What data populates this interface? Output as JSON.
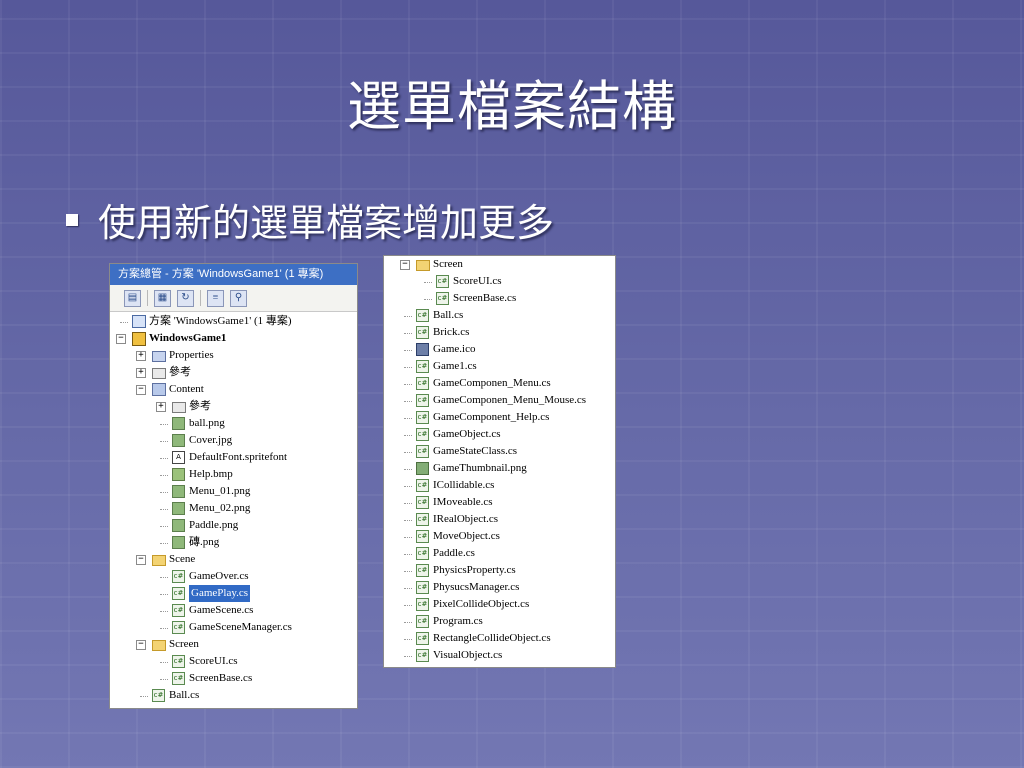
{
  "slide": {
    "title": "選單檔案結構",
    "bullet": "使用新的選單檔案增加更多"
  },
  "left_panel": {
    "title": "方案總管 - 方案 'WindowsGame1' (1 專案)",
    "toolbar_icons": [
      "properties-icon",
      "show-all-files-icon",
      "refresh-icon",
      "view-code-icon",
      "class-diagram-icon"
    ],
    "items": [
      {
        "label": "方案 'WindowsGame1' (1 專案)",
        "icon": "solution-icon",
        "level": 0
      },
      {
        "label": "WindowsGame1",
        "icon": "project-icon",
        "level": 0,
        "toggle": "−",
        "bold": true
      },
      {
        "label": "Properties",
        "icon": "properties-folder-icon",
        "level": 1,
        "toggle": "+"
      },
      {
        "label": "參考",
        "icon": "references-icon",
        "level": 1,
        "toggle": "+"
      },
      {
        "label": "Content",
        "icon": "content-icon",
        "level": 1,
        "toggle": "−"
      },
      {
        "label": "參考",
        "icon": "references-icon",
        "level": 2,
        "toggle": "+"
      },
      {
        "label": "ball.png",
        "icon": "image-file-icon",
        "level": 2
      },
      {
        "label": "Cover.jpg",
        "icon": "image-file-icon",
        "level": 2
      },
      {
        "label": "DefaultFont.spritefont",
        "icon": "font-file-icon",
        "level": 2
      },
      {
        "label": "Help.bmp",
        "icon": "bitmap-file-icon",
        "level": 2
      },
      {
        "label": "Menu_01.png",
        "icon": "image-file-icon",
        "level": 2
      },
      {
        "label": "Menu_02.png",
        "icon": "image-file-icon",
        "level": 2
      },
      {
        "label": "Paddle.png",
        "icon": "image-file-icon",
        "level": 2
      },
      {
        "label": "磚.png",
        "icon": "image-file-icon",
        "level": 2
      },
      {
        "label": "Scene",
        "icon": "folder-icon",
        "level": 1,
        "toggle": "−"
      },
      {
        "label": "GameOver.cs",
        "icon": "csharp-file-icon",
        "level": 2
      },
      {
        "label": "GamePlay.cs",
        "icon": "csharp-file-icon",
        "level": 2,
        "selected": true
      },
      {
        "label": "GameScene.cs",
        "icon": "csharp-file-icon",
        "level": 2
      },
      {
        "label": "GameSceneManager.cs",
        "icon": "csharp-file-icon",
        "level": 2
      },
      {
        "label": "Screen",
        "icon": "folder-icon",
        "level": 1,
        "toggle": "−"
      },
      {
        "label": "ScoreUI.cs",
        "icon": "csharp-file-icon",
        "level": 2
      },
      {
        "label": "ScreenBase.cs",
        "icon": "csharp-file-icon",
        "level": 2
      },
      {
        "label": "Ball.cs",
        "icon": "csharp-file-icon",
        "level": 1
      }
    ]
  },
  "right_panel": {
    "items": [
      {
        "label": "Screen",
        "icon": "folder-icon",
        "level": 0,
        "toggle": "−"
      },
      {
        "label": "ScoreUI.cs",
        "icon": "csharp-file-icon",
        "level": 1
      },
      {
        "label": "ScreenBase.cs",
        "icon": "csharp-file-icon",
        "level": 1
      },
      {
        "label": "Ball.cs",
        "icon": "csharp-file-icon",
        "level": 0
      },
      {
        "label": "Brick.cs",
        "icon": "csharp-file-icon",
        "level": 0
      },
      {
        "label": "Game.ico",
        "icon": "icon-file-icon",
        "level": 0
      },
      {
        "label": "Game1.cs",
        "icon": "csharp-file-icon",
        "level": 0
      },
      {
        "label": "GameComponen_Menu.cs",
        "icon": "csharp-file-icon",
        "level": 0
      },
      {
        "label": "GameComponen_Menu_Mouse.cs",
        "icon": "csharp-file-icon",
        "level": 0
      },
      {
        "label": "GameComponent_Help.cs",
        "icon": "csharp-file-icon",
        "level": 0
      },
      {
        "label": "GameObject.cs",
        "icon": "csharp-file-icon",
        "level": 0
      },
      {
        "label": "GameStateClass.cs",
        "icon": "csharp-file-icon",
        "level": 0
      },
      {
        "label": "GameThumbnail.png",
        "icon": "thumbnail-file-icon",
        "level": 0
      },
      {
        "label": "ICollidable.cs",
        "icon": "csharp-file-icon",
        "level": 0
      },
      {
        "label": "IMoveable.cs",
        "icon": "csharp-file-icon",
        "level": 0
      },
      {
        "label": "IRealObject.cs",
        "icon": "csharp-file-icon",
        "level": 0
      },
      {
        "label": "MoveObject.cs",
        "icon": "csharp-file-icon",
        "level": 0
      },
      {
        "label": "Paddle.cs",
        "icon": "csharp-file-icon",
        "level": 0
      },
      {
        "label": "PhysicsProperty.cs",
        "icon": "csharp-file-icon",
        "level": 0
      },
      {
        "label": "PhysucsManager.cs",
        "icon": "csharp-file-icon",
        "level": 0
      },
      {
        "label": "PixelCollideObject.cs",
        "icon": "csharp-file-icon",
        "level": 0
      },
      {
        "label": "Program.cs",
        "icon": "csharp-file-icon",
        "level": 0
      },
      {
        "label": "RectangleCollideObject.cs",
        "icon": "csharp-file-icon",
        "level": 0
      },
      {
        "label": "VisualObject.cs",
        "icon": "csharp-file-icon",
        "level": 0
      }
    ]
  },
  "colors": {
    "background": "#5f63a2",
    "selection": "#316ac5",
    "title_bar": "#3d6fc4",
    "text": "#ffffff"
  }
}
